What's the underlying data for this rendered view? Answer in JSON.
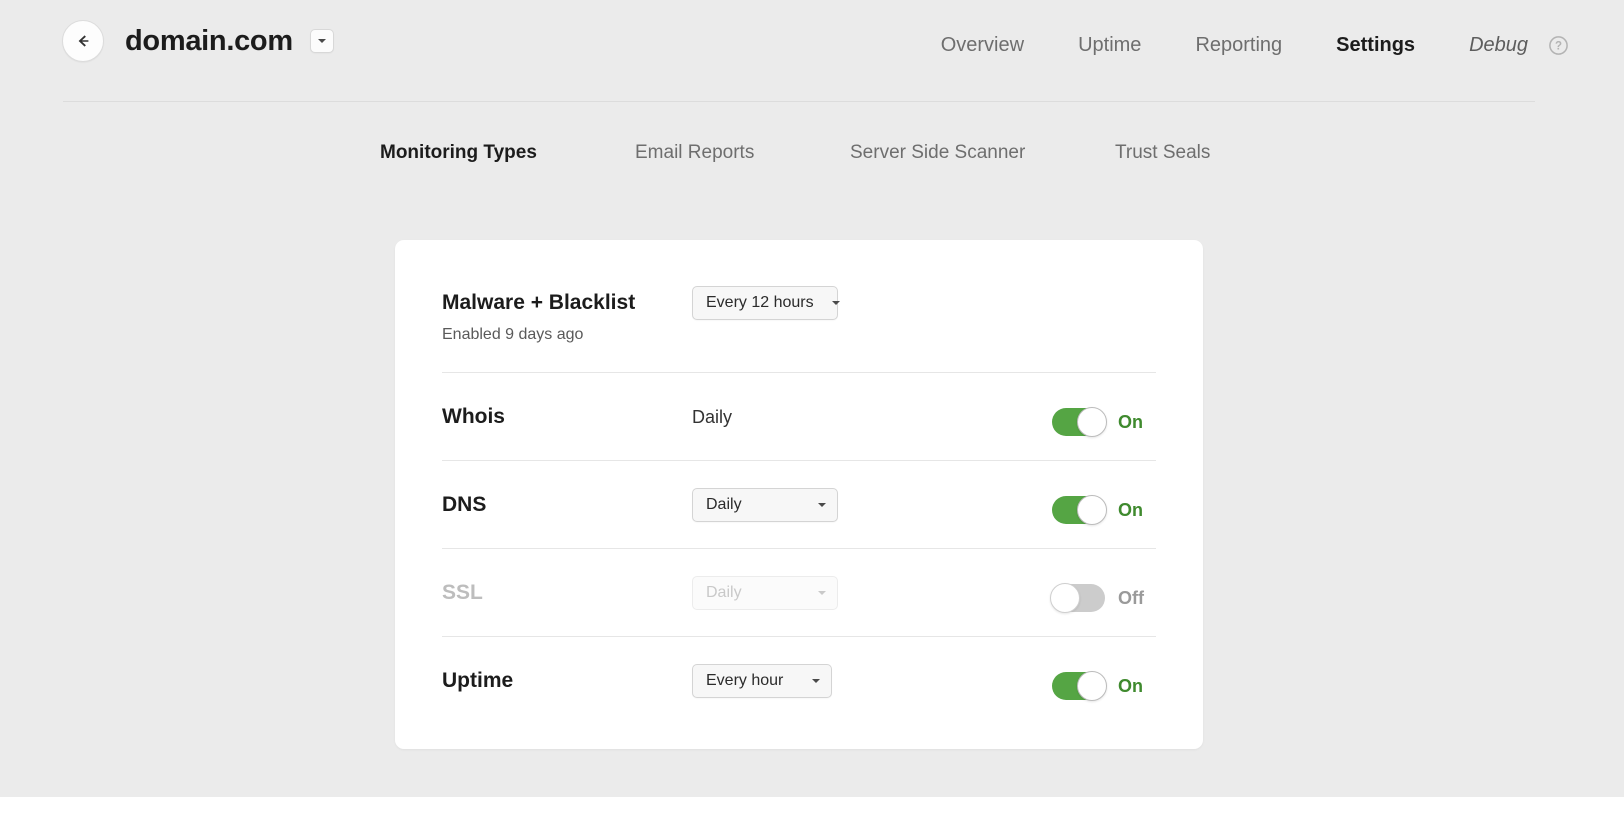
{
  "header": {
    "back_icon": "arrow-left-icon",
    "site_title": "domain.com",
    "site_switcher_icon": "chevron-down-icon",
    "help_icon": "help-circle-icon",
    "nav": [
      {
        "label": "Overview",
        "active": false,
        "style": "normal"
      },
      {
        "label": "Uptime",
        "active": false,
        "style": "normal"
      },
      {
        "label": "Reporting",
        "active": false,
        "style": "normal"
      },
      {
        "label": "Settings",
        "active": true,
        "style": "normal"
      },
      {
        "label": "Debug",
        "active": false,
        "style": "italic"
      }
    ]
  },
  "subtabs": [
    {
      "label": "Monitoring Types",
      "active": true
    },
    {
      "label": "Email Reports",
      "active": false
    },
    {
      "label": "Server Side Scanner",
      "active": false
    },
    {
      "label": "Trust Seals",
      "active": false
    }
  ],
  "monitoring": {
    "rows": [
      {
        "name": "Malware + Blacklist",
        "sub": "Enabled 9 days ago",
        "control_type": "select",
        "select_value": "Every 12 hours",
        "select_options": [
          "Every 12 hours"
        ],
        "has_toggle": false,
        "toggle_state": null,
        "toggle_label": null,
        "disabled": false
      },
      {
        "name": "Whois",
        "sub": null,
        "control_type": "text",
        "select_value": "Daily",
        "select_options": [],
        "has_toggle": true,
        "toggle_state": "on",
        "toggle_label": "On",
        "disabled": false
      },
      {
        "name": "DNS",
        "sub": null,
        "control_type": "select",
        "select_value": "Daily",
        "select_options": [
          "Daily"
        ],
        "has_toggle": true,
        "toggle_state": "on",
        "toggle_label": "On",
        "disabled": false
      },
      {
        "name": "SSL",
        "sub": null,
        "control_type": "select",
        "select_value": "Daily",
        "select_options": [
          "Daily"
        ],
        "has_toggle": true,
        "toggle_state": "off",
        "toggle_label": "Off",
        "disabled": true
      },
      {
        "name": "Uptime",
        "sub": null,
        "control_type": "select",
        "select_value": "Every hour",
        "select_options": [
          "Every hour"
        ],
        "has_toggle": true,
        "toggle_state": "on",
        "toggle_label": "On",
        "disabled": false
      }
    ]
  },
  "colors": {
    "page_background": "#ebebeb",
    "card_background": "#ffffff",
    "toggle_on": "#55a544",
    "toggle_off": "#cccccc",
    "label_on": "#3f8a2e",
    "label_off": "#9a9a9a",
    "text_primary": "#1c1c1c",
    "text_muted": "#6e6e6e",
    "text_disabled": "#bdbdbd"
  }
}
